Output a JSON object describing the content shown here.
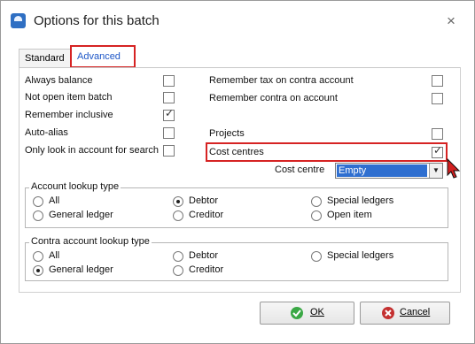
{
  "window": {
    "title": "Options for this batch",
    "close_glyph": "×"
  },
  "tabs": [
    {
      "label": "Standard"
    },
    {
      "label": "Advanced"
    }
  ],
  "options": {
    "always_balance": {
      "label": "Always balance",
      "checked": false
    },
    "not_open_item_batch": {
      "label": "Not open item batch",
      "checked": false
    },
    "remember_inclusive": {
      "label": "Remember inclusive",
      "checked": true
    },
    "auto_alias": {
      "label": "Auto-alias",
      "checked": false
    },
    "only_look_in_account": {
      "label": "Only look in account for search",
      "checked": false
    },
    "remember_tax_contra": {
      "label": "Remember tax on contra account",
      "checked": false
    },
    "remember_contra": {
      "label": "Remember contra on account",
      "checked": false
    },
    "projects": {
      "label": "Projects",
      "checked": false
    },
    "cost_centres": {
      "label": "Cost centres",
      "checked": true
    }
  },
  "cost_centre": {
    "label": "Cost centre",
    "value": "Empty"
  },
  "account_lookup": {
    "title": "Account lookup type",
    "options": [
      "All",
      "Debtor",
      "Special ledgers",
      "General ledger",
      "Creditor",
      "Open item"
    ],
    "selected": "Debtor"
  },
  "contra_lookup": {
    "title": "Contra account lookup type",
    "options": [
      "All",
      "Debtor",
      "Special ledgers",
      "General ledger",
      "Creditor"
    ],
    "selected": "General ledger"
  },
  "buttons": {
    "ok": "OK",
    "cancel": "Cancel"
  },
  "colors": {
    "highlight": "#d62323",
    "selection": "#2f6fd0",
    "ok_icon": "#3aa845",
    "cancel_icon": "#c43030"
  }
}
